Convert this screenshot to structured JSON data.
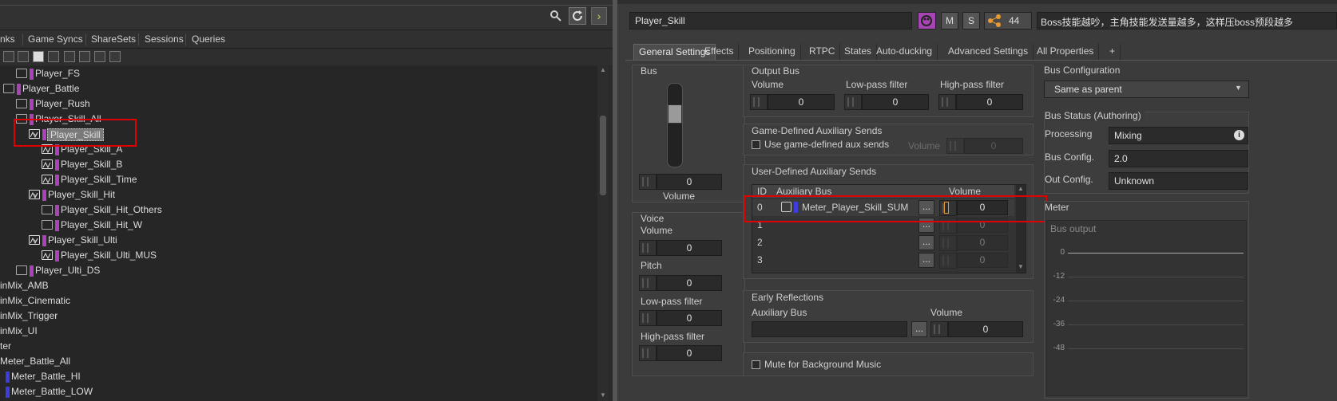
{
  "left": {
    "tabs": [
      "nks",
      "Game Syncs",
      "ShareSets",
      "Sessions",
      "Queries"
    ],
    "tree": [
      {
        "label": "Player_FS",
        "indent": 44,
        "kind": "bus",
        "color": "#a845b4",
        "expander": ""
      },
      {
        "label": "Player_Battle",
        "indent": 28,
        "kind": "folder",
        "color": "#a845b4",
        "expander": ""
      },
      {
        "label": "Player_Rush",
        "indent": 44,
        "kind": "bus",
        "color": "#a845b4",
        "expander": ""
      },
      {
        "label": "Player_Skill_All",
        "indent": 44,
        "kind": "bus",
        "color": "#a845b4",
        "expander": ""
      },
      {
        "label": "Player_Skill",
        "indent": 60,
        "kind": "aux",
        "color": "#a845b4",
        "expander": "v",
        "selected": true
      },
      {
        "label": "Player_Skill_A",
        "indent": 76,
        "kind": "aux",
        "color": "#a845b4",
        "expander": ""
      },
      {
        "label": "Player_Skill_B",
        "indent": 76,
        "kind": "aux",
        "color": "#a845b4",
        "expander": ""
      },
      {
        "label": "Player_Skill_Time",
        "indent": 76,
        "kind": "aux",
        "color": "#a845b4",
        "expander": ""
      },
      {
        "label": "Player_Skill_Hit",
        "indent": 60,
        "kind": "aux",
        "color": "#a845b4",
        "expander": "v"
      },
      {
        "label": "Player_Skill_Hit_Others",
        "indent": 76,
        "kind": "bus",
        "color": "#a845b4",
        "expander": ""
      },
      {
        "label": "Player_Skill_Hit_W",
        "indent": 76,
        "kind": "bus",
        "color": "#a845b4",
        "expander": ""
      },
      {
        "label": "Player_Skill_Ulti",
        "indent": 60,
        "kind": "aux",
        "color": "#a845b4",
        "expander": "v"
      },
      {
        "label": "Player_Skill_Ulti_MUS",
        "indent": 76,
        "kind": "aux",
        "color": "#a845b4",
        "expander": ""
      },
      {
        "label": "Player_Ulti_DS",
        "indent": 44,
        "kind": "bus",
        "color": "#a845b4",
        "expander": ""
      },
      {
        "label": "inMix_AMB",
        "indent": 0,
        "kind": "none",
        "color": "",
        "expander": ""
      },
      {
        "label": "inMix_Cinematic",
        "indent": 0,
        "kind": "none",
        "color": "",
        "expander": ""
      },
      {
        "label": "inMix_Trigger",
        "indent": 0,
        "kind": "none",
        "color": "",
        "expander": ""
      },
      {
        "label": "inMix_UI",
        "indent": 0,
        "kind": "none",
        "color": "",
        "expander": ""
      },
      {
        "label": "ter",
        "indent": 0,
        "kind": "none",
        "color": "",
        "expander": ""
      },
      {
        "label": "Meter_Battle_All",
        "indent": 0,
        "kind": "none",
        "color": "",
        "expander": ""
      },
      {
        "label": "Meter_Battle_HI",
        "indent": 14,
        "kind": "bar",
        "color": "#3d3ddb",
        "expander": ""
      },
      {
        "label": "Meter_Battle_LOW",
        "indent": 14,
        "kind": "bar",
        "color": "#3d3ddb",
        "expander": ""
      }
    ]
  },
  "header": {
    "name": "Player_Skill",
    "m_label": "M",
    "s_label": "S",
    "ref_count": "44",
    "notes": "Boss技能越吵，主角技能发送量越多，这样压boss预段越多"
  },
  "tabs": [
    "General Settings",
    "Effects",
    "Positioning",
    "RTPC",
    "States",
    "Auto-ducking",
    "Advanced Settings",
    "All Properties",
    "+"
  ],
  "bus": {
    "title": "Bus",
    "volume": "0",
    "volume_label": "Volume"
  },
  "voice": {
    "title": "Voice",
    "volume_label": "Volume",
    "volume": "0",
    "pitch_label": "Pitch",
    "pitch": "0",
    "lpf_label": "Low-pass filter",
    "lpf": "0",
    "hpf_label": "High-pass filter",
    "hpf": "0"
  },
  "output_bus": {
    "title": "Output Bus",
    "volume_label": "Volume",
    "volume": "0",
    "lpf_label": "Low-pass filter",
    "lpf": "0",
    "hpf_label": "High-pass filter",
    "hpf": "0"
  },
  "game_aux": {
    "title": "Game-Defined Auxiliary Sends",
    "checkbox_label": "Use game-defined aux sends",
    "volume_label": "Volume",
    "volume": "0"
  },
  "user_aux": {
    "title": "User-Defined Auxiliary Sends",
    "col_id": "ID",
    "col_bus": "Auxiliary Bus",
    "col_volume": "Volume",
    "rows": [
      {
        "id": "0",
        "bus": "Meter_Player_Skill_SUM",
        "volume": "0"
      },
      {
        "id": "1",
        "bus": "",
        "volume": "0"
      },
      {
        "id": "2",
        "bus": "",
        "volume": "0"
      },
      {
        "id": "3",
        "bus": "",
        "volume": "0"
      }
    ],
    "more_label": "..."
  },
  "early_reflections": {
    "title": "Early Reflections",
    "bus_label": "Auxiliary Bus",
    "volume_label": "Volume",
    "volume": "0",
    "more_label": "..."
  },
  "mute_bg": {
    "label": "Mute for Background Music"
  },
  "bus_config": {
    "title": "Bus Configuration",
    "value": "Same as parent"
  },
  "bus_status": {
    "title": "Bus Status (Authoring)",
    "processing_label": "Processing",
    "processing": "Mixing",
    "busconfig_label": "Bus Config.",
    "busconfig": "2.0",
    "outconfig_label": "Out Config.",
    "outconfig": "Unknown"
  },
  "meter": {
    "title": "Meter",
    "label": "Bus output",
    "ticks": [
      "0",
      "-12",
      "-24",
      "-36",
      "-48"
    ]
  }
}
